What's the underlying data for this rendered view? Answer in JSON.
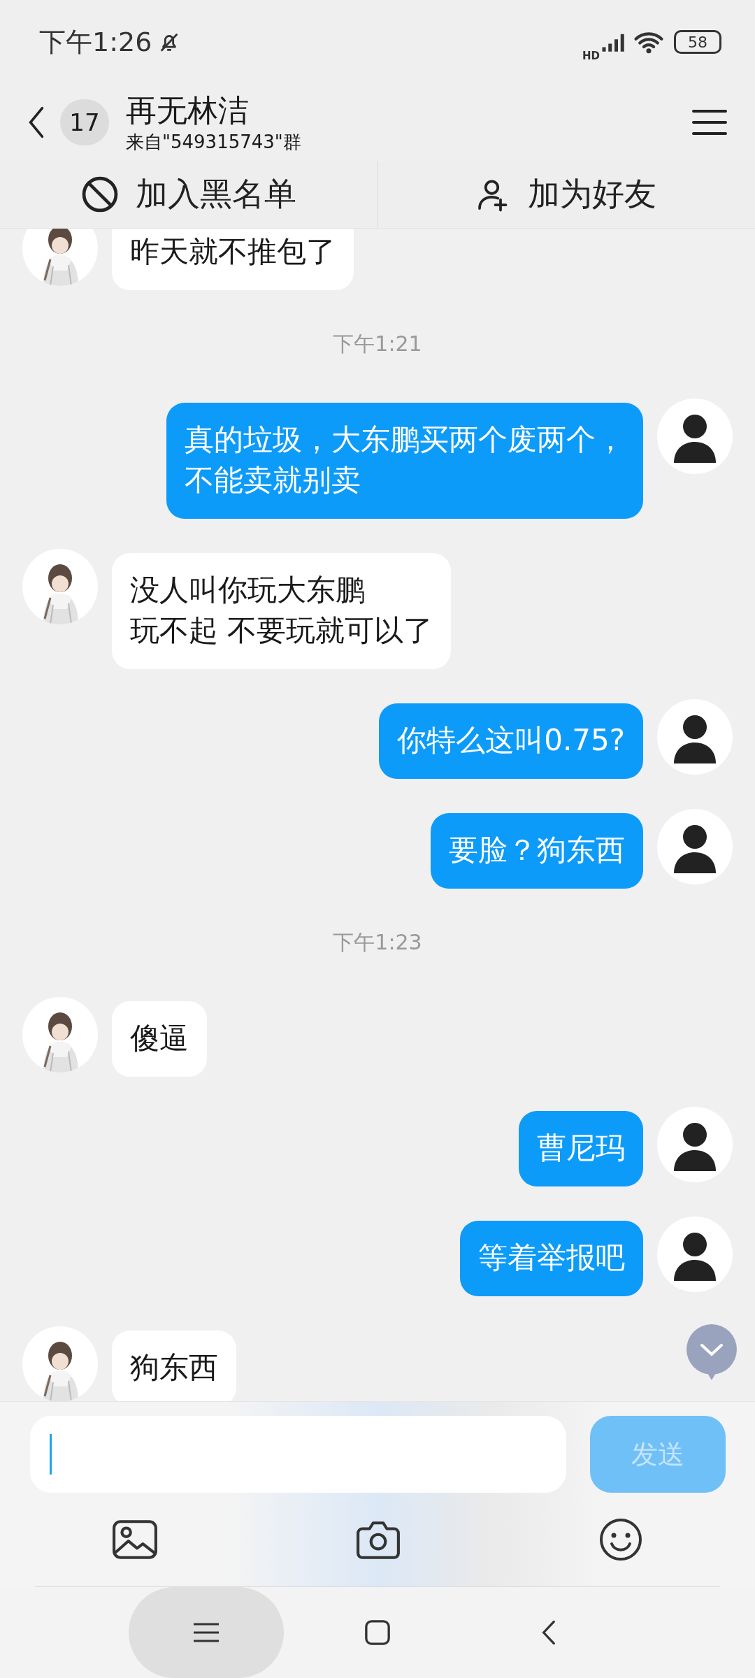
{
  "status_bar": {
    "time": "下午1:26",
    "network_label": "HD",
    "battery": "58"
  },
  "header": {
    "unread_count": "17",
    "title": "再无林洁",
    "subtitle": "来自\"549315743\"群"
  },
  "actions": [
    {
      "kind": "block",
      "label": "加入黑名单"
    },
    {
      "kind": "add_friend",
      "label": "加为好友"
    }
  ],
  "messages": [
    {
      "kind": "received",
      "lines": [
        "昨天就不推包了"
      ]
    },
    {
      "kind": "time",
      "text": "下午1:21"
    },
    {
      "kind": "sent",
      "lines": [
        "真的垃圾，大东鹏买两个废两个，",
        "不能卖就别卖"
      ]
    },
    {
      "kind": "received",
      "lines": [
        "没人叫你玩大东鹏",
        "玩不起 不要玩就可以了"
      ]
    },
    {
      "kind": "sent",
      "lines": [
        "你特么这叫0.75?"
      ]
    },
    {
      "kind": "sent",
      "lines": [
        "要脸？狗东西"
      ]
    },
    {
      "kind": "time",
      "text": "下午1:23"
    },
    {
      "kind": "received",
      "lines": [
        "傻逼"
      ]
    },
    {
      "kind": "sent",
      "lines": [
        "曹尼玛"
      ]
    },
    {
      "kind": "sent",
      "lines": [
        "等着举报吧"
      ]
    },
    {
      "kind": "received",
      "lines": [
        "狗东西"
      ]
    }
  ],
  "composer": {
    "send_label": "发送",
    "send_disabled": true
  }
}
